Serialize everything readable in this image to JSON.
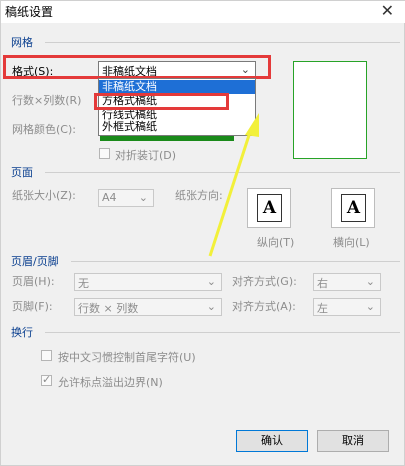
{
  "window": {
    "title": "稿纸设置",
    "close_glyph": "✕"
  },
  "grid": {
    "group_title": "网格",
    "format_label": "格式(S):",
    "format_value": "非稿纸文档",
    "dropdown_options": [
      "非稿纸文档",
      "方格式稿纸",
      "行线式稿纸",
      "外框式稿纸"
    ],
    "rows_cols_label": "行数×列数(R)",
    "color_label": "网格颜色(C):",
    "fold_label": "对折装订(D)"
  },
  "page": {
    "group_title": "页面",
    "paper_size_label": "纸张大小(Z):",
    "paper_size_value": "A4",
    "orientation_label": "纸张方向:",
    "portrait_label": "纵向(T)",
    "landscape_label": "横向(L)",
    "page_glyph": "A"
  },
  "header_footer": {
    "group_title": "页眉/页脚",
    "header_label": "页眉(H):",
    "header_value": "无",
    "footer_label": "页脚(F):",
    "footer_value": "行数 × 列数",
    "align_g_label": "对齐方式(G):",
    "align_g_value": "右",
    "align_a_label": "对齐方式(A):",
    "align_a_value": "左"
  },
  "wrap": {
    "group_title": "换行",
    "option1": "按中文习惯控制首尾字符(U)",
    "option2": "允许标点溢出边界(N)"
  },
  "buttons": {
    "ok": "确认",
    "cancel": "取消"
  },
  "colors": {
    "annotation_red": "#e43a3a",
    "annotation_arrow": "#f2f03a",
    "selection_blue": "#1e6fd6",
    "preview_green": "#27a327"
  }
}
